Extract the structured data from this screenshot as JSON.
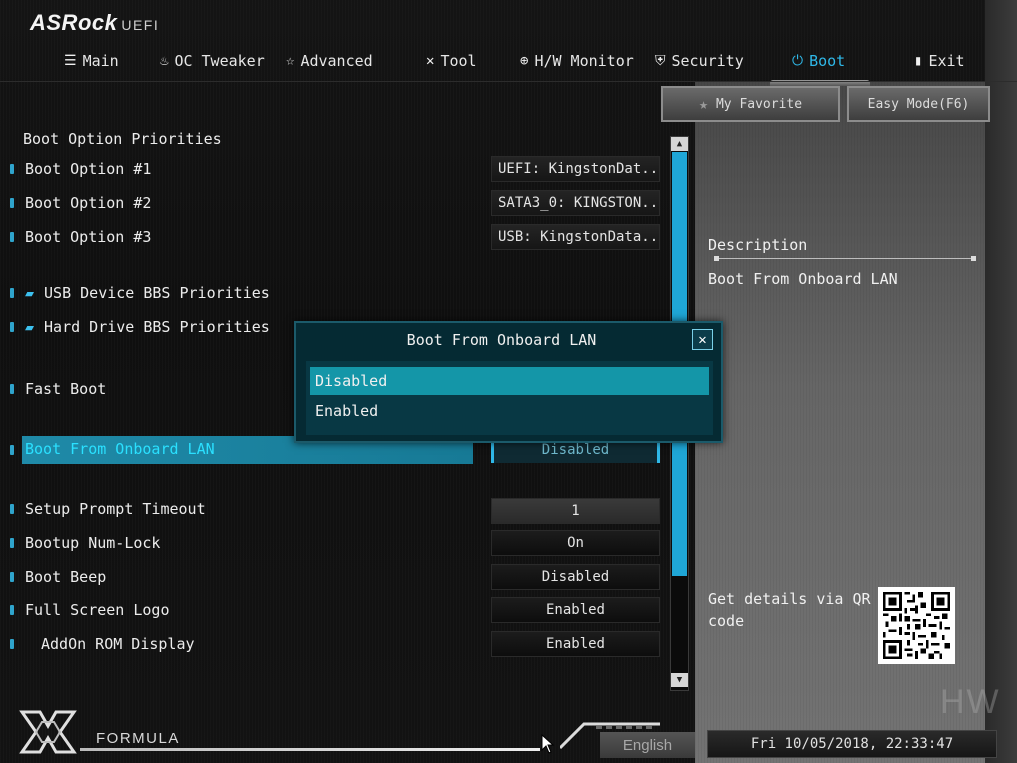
{
  "header": {
    "brand": "ASRock",
    "brand_suffix": "UEFI"
  },
  "tabs": [
    {
      "label": "Main",
      "icon": "list-icon"
    },
    {
      "label": "OC Tweaker",
      "icon": "flame-icon"
    },
    {
      "label": "Advanced",
      "icon": "star-arrow-icon"
    },
    {
      "label": "Tool",
      "icon": "tools-icon"
    },
    {
      "label": "H/W Monitor",
      "icon": "monitor-target-icon"
    },
    {
      "label": "Security",
      "icon": "shield-icon"
    },
    {
      "label": "Boot",
      "icon": "power-icon",
      "active": true
    },
    {
      "label": "Exit",
      "icon": "exit-door-icon"
    }
  ],
  "top_buttons": {
    "favorite": "My Favorite",
    "easy_mode": "Easy Mode(F6)"
  },
  "settings": {
    "section_title": "Boot Option Priorities",
    "boot1": {
      "label": "Boot Option #1",
      "value": "UEFI: KingstonDat..."
    },
    "boot2": {
      "label": "Boot Option #2",
      "value": "SATA3_0: KINGSTON..."
    },
    "boot3": {
      "label": "Boot Option #3",
      "value": "USB: KingstonData..."
    },
    "usb_bbs": {
      "label": "USB Device BBS Priorities"
    },
    "hdd_bbs": {
      "label": "Hard Drive BBS Priorities"
    },
    "fast_boot": {
      "label": "Fast Boot"
    },
    "onboard_lan": {
      "label": "Boot From Onboard LAN",
      "value": "Disabled"
    },
    "setup_timeout": {
      "label": "Setup Prompt Timeout",
      "value": "1"
    },
    "numlock": {
      "label": "Bootup Num-Lock",
      "value": "On"
    },
    "boot_beep": {
      "label": "Boot Beep",
      "value": "Disabled"
    },
    "full_logo": {
      "label": "Full Screen Logo",
      "value": "Enabled"
    },
    "addon_rom": {
      "label": "AddOn ROM Display",
      "value": "Enabled"
    }
  },
  "description": {
    "title": "Description",
    "text": "Boot From Onboard LAN",
    "qr_text": "Get details via QR code"
  },
  "modal": {
    "title": "Boot From Onboard LAN",
    "options": [
      "Disabled",
      "Enabled"
    ],
    "selected": "Disabled"
  },
  "footer": {
    "formula": "FORMULA",
    "language": "English",
    "datetime": "Fri 10/05/2018, 22:33:47"
  },
  "watermark": "HW",
  "colors": {
    "accent": "#2fb8e8",
    "selection": "#1496a8",
    "modal_bg": "#052a33"
  }
}
